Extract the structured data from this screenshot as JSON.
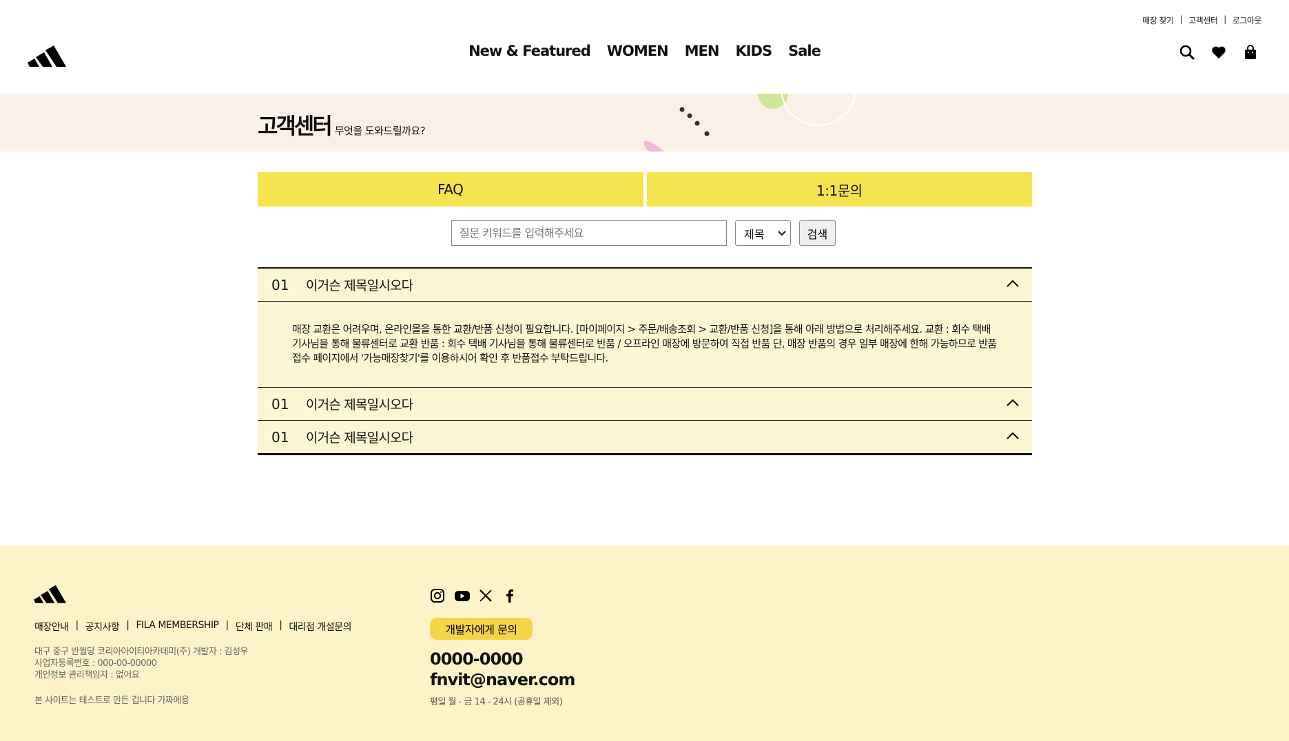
{
  "header": {
    "util_links": [
      "매장 찾기",
      "고객센터",
      "로그아웃"
    ],
    "util_sep": "|",
    "nav": [
      "New & Featured",
      "WOMEN",
      "MEN",
      "KIDS",
      "Sale"
    ],
    "icons": [
      "search-icon",
      "heart-icon",
      "bag-icon"
    ]
  },
  "hero": {
    "title": "고객센터",
    "subtitle": "무엇을 도와드릴까요?"
  },
  "tabs": {
    "faq": "FAQ",
    "inquiry": "1:1문의"
  },
  "search": {
    "placeholder": "질문 키워드를 입력해주세요",
    "select_value": "제목",
    "button": "검색"
  },
  "faq": {
    "items": [
      {
        "num": "01",
        "title": "이거슨 제목일시오다",
        "body": "매장 교환은 어려우며, 온라인몰을 통한 교환/반품 신청이 필요합니다. [마이페이지 > 주문/배송조회 > 교환/반품 신청]을 통해 아래 방법으로 처리해주세요. 교환 : 회수 택배 기사님을 통해 물류센터로 교환 반품 : 회수 택배 기사님을 통해 물류센터로 반품 / 오프라인 매장에 방문하여 직접 반품 단, 매장 반품의 경우 일부 매장에 한해 가능하므로 반품접수 페이지에서 '가능매장찾기'를 이용하시어 확인 후 반품접수 부탁드립니다."
      },
      {
        "num": "01",
        "title": "이거슨 제목일시오다"
      },
      {
        "num": "01",
        "title": "이거슨 제목일시오다"
      }
    ]
  },
  "footer": {
    "links": [
      "매장안내",
      "공지사항",
      "FILA MEMBERSHIP",
      "단체 판매",
      "대리점 개설문의"
    ],
    "link_sep": "|",
    "info": [
      "대구 중구 반월당 코리아아이티아카데미(주) 개발자 : 김성우",
      "사업자등록번호 : 000-00-00000",
      "개인정보 관리책임자 : 없어요"
    ],
    "note": "본 사이트는 테스트로 만든 겁니다 가짜에용",
    "social": [
      "instagram-icon",
      "youtube-icon",
      "x-icon",
      "facebook-icon"
    ],
    "dev_button": "개발자에게 문의",
    "phone": "0000-0000",
    "email": "fnvit@naver.com",
    "hours": "평일 월 - 금 14 - 24시 (공휴일 제외)"
  },
  "colors": {
    "tab_yellow": "#f5e34f",
    "hero_bg": "#f9f0e8",
    "faq_bg": "#fdf6d3",
    "footer_bg": "#fcf4c8",
    "dev_button": "#f5d44a"
  }
}
